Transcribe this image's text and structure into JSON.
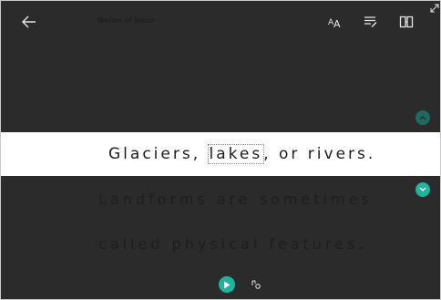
{
  "window": {
    "title": "Bodies of water"
  },
  "toolbar": {
    "back_icon": "back-arrow-icon",
    "text_options_label": "AA",
    "text_options_icon": "text-options-icon",
    "grammar_icon": "grammar-options-icon",
    "picture_dictionary_icon": "book-icon",
    "expand_icon": "expand-icon"
  },
  "reader": {
    "focus_line": {
      "before": "Glaciers, ",
      "highlighted_word": "lakes",
      "after": ", or rivers."
    },
    "next_lines": [
      "Landforms are sometimes",
      "called physical features."
    ]
  },
  "controls": {
    "scroll_up_icon": "chevron-up-icon",
    "scroll_down_icon": "chevron-down-icon",
    "play_icon": "play-icon",
    "voice_settings_icon": "voice-settings-icon"
  },
  "colors": {
    "dark_background": "#2b2b2b",
    "accent_teal": "#1fb3a0",
    "accent_teal_dim": "#1f6b63"
  }
}
